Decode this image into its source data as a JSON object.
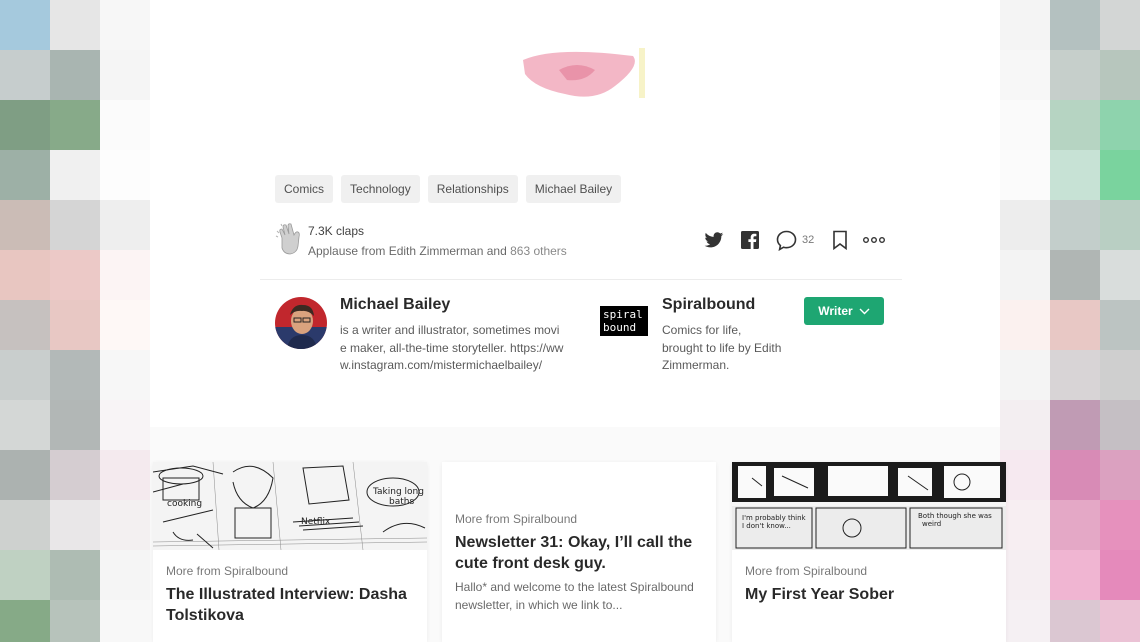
{
  "tags": [
    "Comics",
    "Technology",
    "Relationships",
    "Michael Bailey"
  ],
  "claps": {
    "count": "7.3K claps",
    "applause_prefix": "Applause from Edith Zimmerman and",
    "applause_others": "863 others"
  },
  "actions": {
    "share_twitter_icon": "twitter-icon",
    "share_facebook_icon": "facebook-icon",
    "responses_icon": "comment-bubble-icon",
    "responses_count": "32",
    "bookmark_icon": "bookmark-icon",
    "more_icon": "more-dots-icon"
  },
  "author": {
    "name": "Michael Bailey",
    "bio": "is a writer and illustrator, sometimes movie maker, all-the-time storyteller. https://www.instagram.com/mistermichaelbailey/"
  },
  "publication": {
    "name": "Spiralbound",
    "logo_line1": "spiral",
    "logo_line2": "bound",
    "description": "Comics for life, brought to life by Edith Zimmerman.",
    "follow_label": "Writer"
  },
  "cards": [
    {
      "kicker": "More from Spiralbound",
      "title": "The Illustrated Interview: Dasha Tolstikova",
      "excerpt": ""
    },
    {
      "kicker": "More from Spiralbound",
      "title": "Newsletter 31: Okay, I’ll call the cute front desk guy.",
      "excerpt": "Hallo* and welcome to the latest Spiralbound newsletter, in which we link to..."
    },
    {
      "kicker": "More from Spiralbound",
      "title": "My First Year Sober",
      "excerpt": ""
    }
  ],
  "colors": {
    "accent_green": "#1ea672",
    "tag_bg": "#f0f0f0"
  }
}
